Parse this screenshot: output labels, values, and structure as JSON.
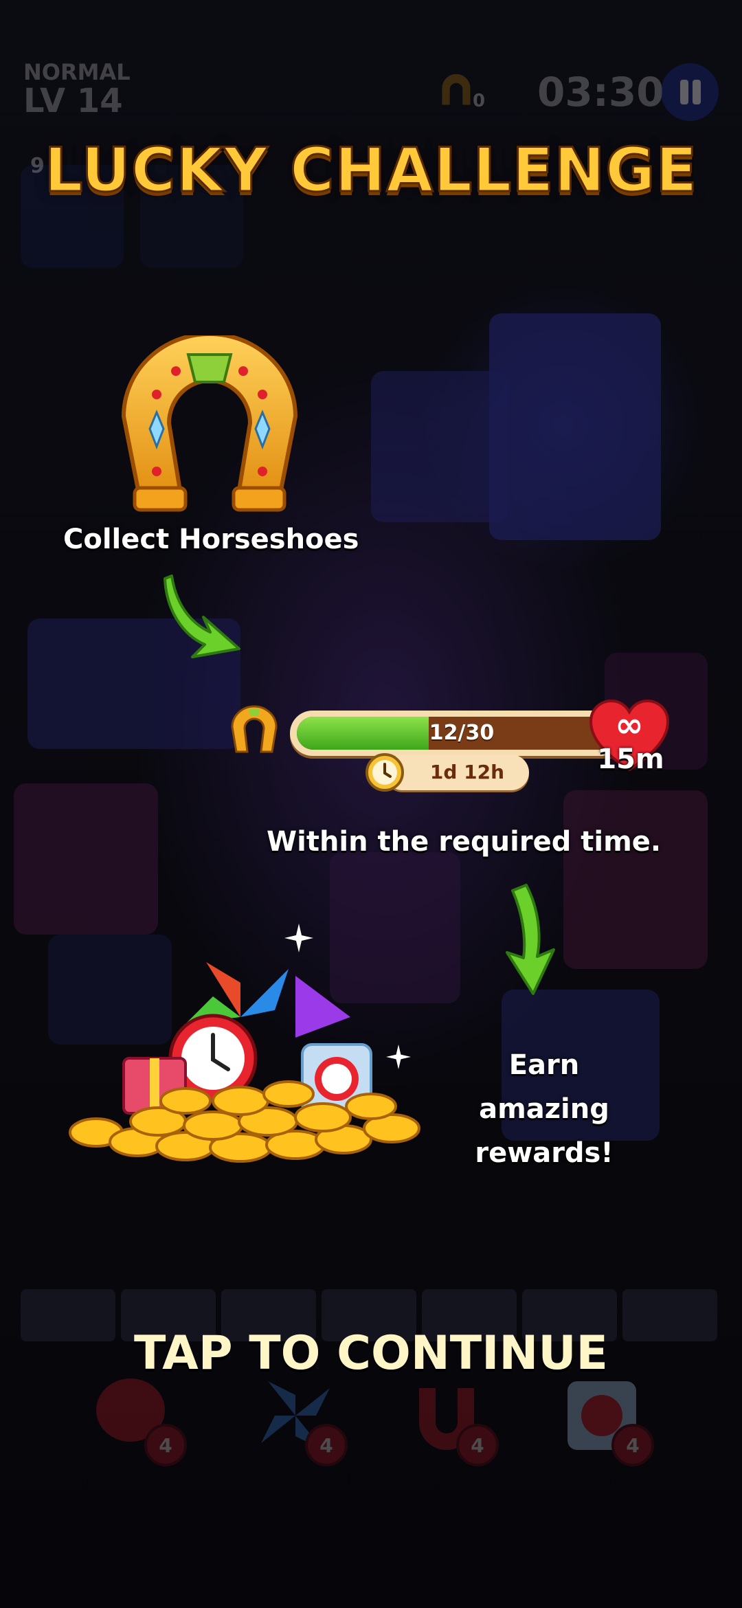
{
  "hud": {
    "mode": "NORMAL",
    "level": "LV 14",
    "horseshoe_count": "0",
    "timer": "03:30",
    "slot_count": "9"
  },
  "popup": {
    "title": "LUCKY CHALLENGE",
    "step1_text": "Collect Horseshoes",
    "progress_text": "12/30",
    "progress_value": 12,
    "progress_max": 30,
    "time_left": "1d 12h",
    "lives_symbol": "∞",
    "lives_timer": "15m",
    "step2_text": "Within the required time.",
    "step3_line1": "Earn amazing",
    "step3_line2": "rewards!",
    "continue_label": "TAP TO CONTINUE"
  },
  "boosters": [
    {
      "icon": "boxing-glove-icon",
      "count": "4"
    },
    {
      "icon": "pinwheel-icon",
      "count": "4"
    },
    {
      "icon": "magnet-icon",
      "count": "4"
    },
    {
      "icon": "frozen-clock-icon",
      "count": "4"
    }
  ],
  "colors": {
    "title": "#ffc93a",
    "progress_fill": "#3ea61b",
    "progress_track": "#7a3b17",
    "heart": "#e8242f",
    "arrow": "#6cd02a"
  }
}
